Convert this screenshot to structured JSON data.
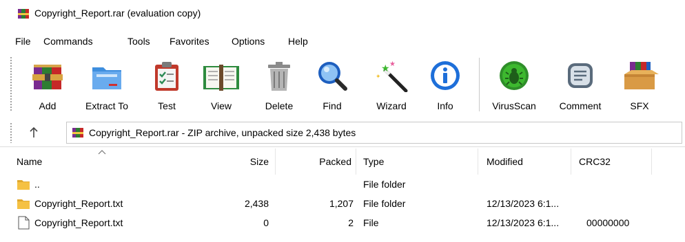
{
  "window": {
    "title": "Copyright_Report.rar (evaluation copy)"
  },
  "menu": [
    "File",
    "Commands",
    "Tools",
    "Favorites",
    "Options",
    "Help"
  ],
  "toolbar": {
    "buttons": [
      {
        "label": "Add",
        "icon": "add-icon"
      },
      {
        "label": "Extract To",
        "icon": "extract-to-icon"
      },
      {
        "label": "Test",
        "icon": "test-icon"
      },
      {
        "label": "View",
        "icon": "view-icon"
      },
      {
        "label": "Delete",
        "icon": "delete-icon"
      },
      {
        "label": "Find",
        "icon": "find-icon"
      },
      {
        "label": "Wizard",
        "icon": "wizard-icon"
      },
      {
        "label": "Info",
        "icon": "info-icon"
      },
      {
        "label": "VirusScan",
        "icon": "virus-scan-icon"
      },
      {
        "label": "Comment",
        "icon": "comment-icon"
      },
      {
        "label": "SFX",
        "icon": "sfx-icon"
      }
    ]
  },
  "address": {
    "text": "Copyright_Report.rar - ZIP archive, unpacked size 2,438 bytes",
    "up_icon": "up-arrow-icon"
  },
  "columns": [
    "Name",
    "Size",
    "Packed",
    "Type",
    "Modified",
    "CRC32"
  ],
  "rows": [
    {
      "name": "..",
      "size": "",
      "packed": "",
      "type": "File folder",
      "modified": "",
      "crc": "",
      "icon": "folder-icon"
    },
    {
      "name": "Copyright_Report.txt",
      "size": "2,438",
      "packed": "1,207",
      "type": "File folder",
      "modified": "12/13/2023 6:1...",
      "crc": "",
      "icon": "folder-icon"
    },
    {
      "name": "Copyright_Report.txt",
      "size": "0",
      "packed": "2",
      "type": "File",
      "modified": "12/13/2023 6:1...",
      "crc": "00000000",
      "icon": "file-icon"
    }
  ],
  "colors": {
    "folder": "#F5C143",
    "accent_blue": "#1E6FD9",
    "virus_green": "#3DB82F"
  }
}
